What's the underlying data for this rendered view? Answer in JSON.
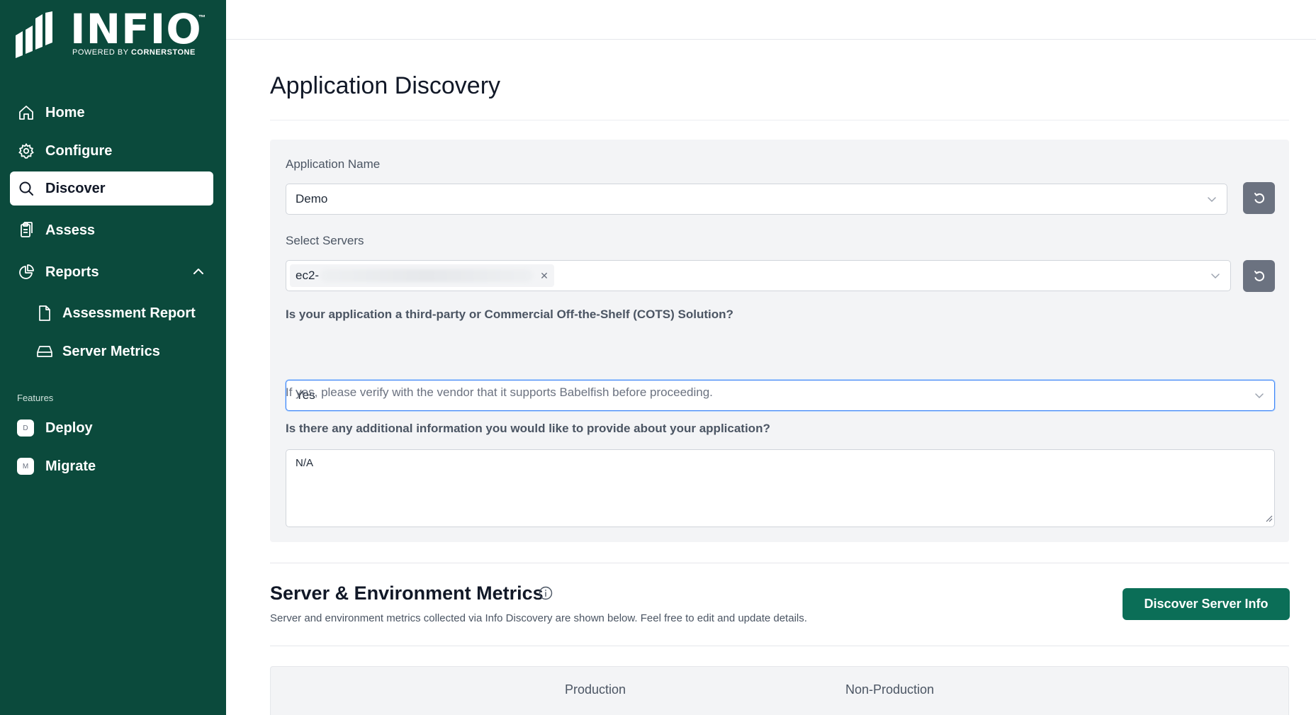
{
  "brand": {
    "name": "INFIO",
    "tm": "™",
    "tagline_prefix": "POWERED BY ",
    "tagline_brand": "CORNERSTONE"
  },
  "sidebar": {
    "items": [
      {
        "label": "Home",
        "icon": "home-icon"
      },
      {
        "label": "Configure",
        "icon": "gear-icon"
      },
      {
        "label": "Discover",
        "icon": "search-icon",
        "active": true
      },
      {
        "label": "Assess",
        "icon": "clipboard-icon"
      },
      {
        "label": "Reports",
        "icon": "pie-chart-icon",
        "expanded": true
      }
    ],
    "report_subitems": [
      {
        "label": "Assessment Report",
        "icon": "document-icon"
      },
      {
        "label": "Server Metrics",
        "icon": "hard-drive-icon"
      }
    ],
    "features_label": "Features",
    "features": [
      {
        "label": "Deploy",
        "badge": "D"
      },
      {
        "label": "Migrate",
        "badge": "M"
      }
    ]
  },
  "page": {
    "title": "Application Discovery"
  },
  "form": {
    "app_name_label": "Application Name",
    "app_name_value": "Demo",
    "servers_label": "Select Servers",
    "server_tag_prefix": "ec2-",
    "cots_question": "Is your application a third-party or Commercial Off-the-Shelf (COTS) Solution?",
    "cots_value": "Yes",
    "cots_hint": "If yes, please verify with the vendor that it supports Babelfish before proceeding.",
    "additional_question": "Is there any additional information you would like to provide about your application?",
    "additional_value": "N/A"
  },
  "metrics": {
    "title": "Server & Environment Metrics",
    "description": "Server and environment metrics collected via Info Discovery are shown below. Feel free to edit and update details.",
    "button_label": "Discover Server Info",
    "columns": [
      "Production",
      "Non-Production"
    ]
  },
  "colors": {
    "sidebar_bg": "#0b4a3c",
    "primary": "#0b6e57",
    "refresh_btn": "#6b7280",
    "focus_border": "#3b82f6"
  }
}
